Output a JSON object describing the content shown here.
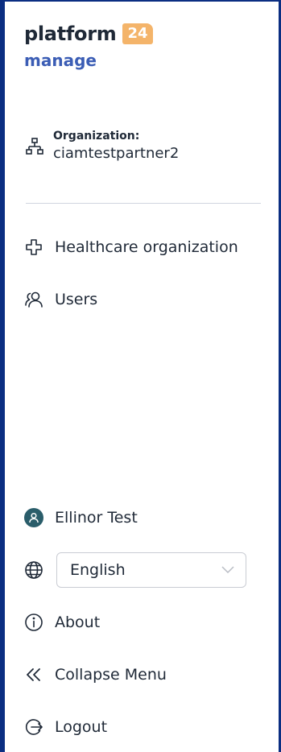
{
  "brand": {
    "word": "platform",
    "badge": "24",
    "sub": "manage",
    "badge_color": "#f4b46a",
    "sub_color": "#3b5db5"
  },
  "organization": {
    "icon": "sitemap-icon",
    "label": "Organization:",
    "value": "ciamtestpartner2"
  },
  "nav": {
    "items": [
      {
        "label": "Healthcare organization",
        "icon": "medical-cross-icon"
      },
      {
        "label": "Users",
        "icon": "users-icon"
      }
    ]
  },
  "footer": {
    "user": {
      "name": "Ellinor Test",
      "avatar_color": "#2a5d6a"
    },
    "language": {
      "icon": "globe-icon",
      "selected": "English"
    },
    "about": {
      "label": "About",
      "icon": "info-icon"
    },
    "collapse": {
      "label": "Collapse Menu",
      "icon": "double-chevron-left-icon"
    },
    "logout": {
      "label": "Logout",
      "icon": "logout-icon"
    }
  },
  "colors": {
    "frame": "#0b2e82",
    "text": "#1f2937"
  }
}
